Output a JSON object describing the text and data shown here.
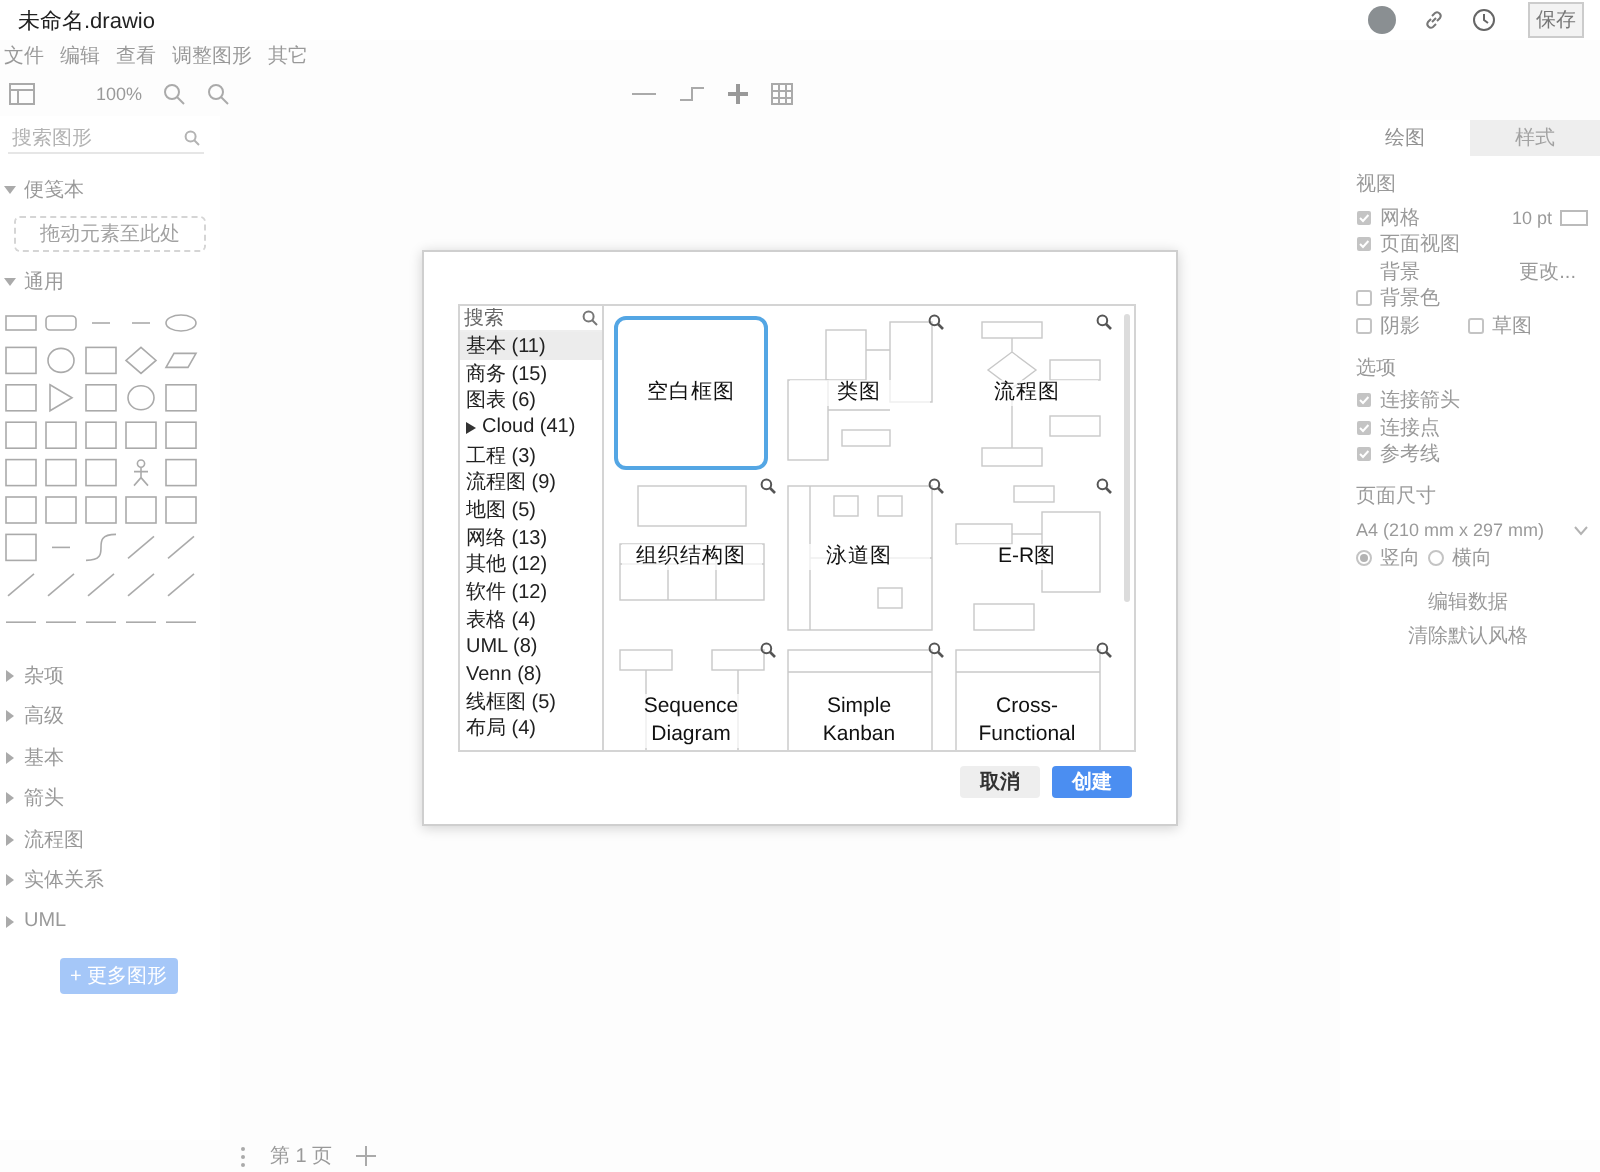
{
  "titlebar": {
    "title": "未命名.drawio",
    "save_button": "保存"
  },
  "menu": [
    "文件",
    "编辑",
    "查看",
    "调整图形",
    "其它"
  ],
  "toolbar": {
    "zoom": "100%"
  },
  "sidebar": {
    "search": {
      "placeholder": "搜索图形"
    },
    "scratchpad": {
      "title": "便笺本",
      "drop_hint": "拖动元素至此处"
    },
    "sections": [
      {
        "label": "通用",
        "expanded": true
      },
      {
        "label": "杂项",
        "expanded": false
      },
      {
        "label": "高级",
        "expanded": false
      },
      {
        "label": "基本",
        "expanded": false
      },
      {
        "label": "箭头",
        "expanded": false
      },
      {
        "label": "流程图",
        "expanded": false
      },
      {
        "label": "实体关系",
        "expanded": false
      },
      {
        "label": "UML",
        "expanded": false
      }
    ],
    "more_button": "+ 更多图形"
  },
  "format_panel": {
    "tabs": [
      {
        "label": "绘图",
        "selected": true
      },
      {
        "label": "样式",
        "selected": false
      }
    ],
    "view": {
      "title": "视图",
      "rows": [
        {
          "kind": "check",
          "label": "网格",
          "checked": true,
          "value": "10 pt"
        },
        {
          "kind": "check",
          "label": "页面视图",
          "checked": true
        },
        {
          "kind": "action",
          "label": "背景",
          "action": "更改..."
        },
        {
          "kind": "check",
          "label": "背景色",
          "checked": false
        },
        {
          "kind": "pair",
          "label": "阴影",
          "checked": false,
          "second": {
            "label": "草图",
            "checked": false
          }
        }
      ]
    },
    "options": {
      "title": "选项",
      "rows": [
        {
          "kind": "check",
          "label": "连接箭头",
          "checked": true
        },
        {
          "kind": "check",
          "label": "连接点",
          "checked": true
        },
        {
          "kind": "check",
          "label": "参考线",
          "checked": true
        }
      ]
    },
    "page_size": {
      "title": "页面尺寸",
      "value": "A4 (210 mm x 297 mm)",
      "orientations": [
        {
          "label": "竖向",
          "selected": true
        },
        {
          "label": "横向",
          "selected": false
        }
      ]
    },
    "links": [
      "编辑数据",
      "清除默认风格"
    ]
  },
  "footer": {
    "page_tab": "第 1 页"
  },
  "dialog": {
    "search": {
      "placeholder": "搜索"
    },
    "categories": [
      {
        "label": "基本 (11)",
        "selected": true,
        "collapsed_group": false
      },
      {
        "label": "商务 (15)",
        "selected": false,
        "collapsed_group": false
      },
      {
        "label": "图表 (6)",
        "selected": false,
        "collapsed_group": false
      },
      {
        "label": "Cloud (41)",
        "selected": false,
        "collapsed_group": true
      },
      {
        "label": "工程 (3)",
        "selected": false,
        "collapsed_group": false
      },
      {
        "label": "流程图 (9)",
        "selected": false,
        "collapsed_group": false
      },
      {
        "label": "地图 (5)",
        "selected": false,
        "collapsed_group": false
      },
      {
        "label": "网络 (13)",
        "selected": false,
        "collapsed_group": false
      },
      {
        "label": "其他 (12)",
        "selected": false,
        "collapsed_group": false
      },
      {
        "label": "软件 (12)",
        "selected": false,
        "collapsed_group": false
      },
      {
        "label": "表格 (4)",
        "selected": false,
        "collapsed_group": false
      },
      {
        "label": "UML (8)",
        "selected": false,
        "collapsed_group": false
      },
      {
        "label": "Venn (8)",
        "selected": false,
        "collapsed_group": false
      },
      {
        "label": "线框图 (5)",
        "selected": false,
        "collapsed_group": false
      },
      {
        "label": "布局 (4)",
        "selected": false,
        "collapsed_group": false
      }
    ],
    "templates": [
      {
        "label": "空白框图",
        "kind": "blank",
        "selected": true
      },
      {
        "label": "类图",
        "kind": "template",
        "selected": false
      },
      {
        "label": "流程图",
        "kind": "template",
        "selected": false
      },
      {
        "label": "组织结构图",
        "kind": "template",
        "selected": false
      },
      {
        "label": "泳道图",
        "kind": "template",
        "selected": false
      },
      {
        "label": "E-R图",
        "kind": "template",
        "selected": false
      },
      {
        "label": "Sequence Diagram",
        "kind": "template",
        "selected": false
      },
      {
        "label": "Simple Kanban",
        "kind": "template",
        "selected": false
      },
      {
        "label": "Cross-Functional",
        "kind": "template",
        "selected": false
      }
    ],
    "buttons": [
      {
        "label": "取消",
        "kind": "secondary"
      },
      {
        "label": "创建",
        "kind": "primary"
      }
    ]
  }
}
